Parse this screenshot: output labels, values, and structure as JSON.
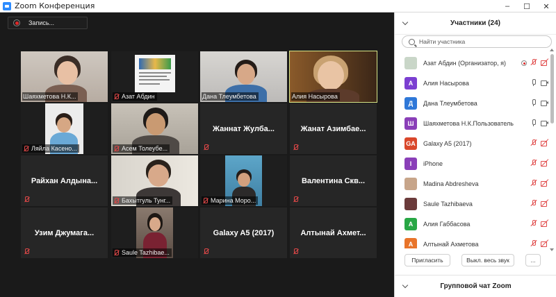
{
  "window": {
    "title": "Zoom Конференция"
  },
  "recording": {
    "label": "Запись..."
  },
  "tiles": [
    {
      "name": "Шаяхметова Н.К...",
      "muted": false,
      "video": true
    },
    {
      "name": "Азат Абдин",
      "muted": true,
      "video": true
    },
    {
      "name": "Дана Тлеумбетова",
      "muted": false,
      "video": true
    },
    {
      "name": "Алия Насырова",
      "muted": false,
      "video": true,
      "active": true
    },
    {
      "name": "Ляйла Касено...",
      "muted": true,
      "video": true
    },
    {
      "name": "Асем Толеубе...",
      "muted": true,
      "video": true
    },
    {
      "name": "Жаннат Жулба...",
      "muted": true,
      "video": false
    },
    {
      "name": "Жанат Азимбае...",
      "muted": true,
      "video": false
    },
    {
      "name": "Райхан Алдына...",
      "muted": true,
      "video": false
    },
    {
      "name": "Бахытгуль Тунг...",
      "muted": true,
      "video": true
    },
    {
      "name": "Марина Моро...",
      "muted": true,
      "video": true
    },
    {
      "name": "Валентина Скв...",
      "muted": true,
      "video": false
    },
    {
      "name": "Узим Джумага...",
      "muted": true,
      "video": false
    },
    {
      "name": "Saule Tazhibae...",
      "muted": true,
      "video": true
    },
    {
      "name": "Galaxy A5 (2017)",
      "muted": true,
      "video": false
    },
    {
      "name": "Алтынай Ахмет...",
      "muted": true,
      "video": false
    }
  ],
  "participants_panel": {
    "title": "Участники (24)",
    "search_placeholder": "Найти участника",
    "participants": [
      {
        "name": "Азат Абдин (Организатор, я)",
        "avatar_letter": "",
        "avatar_color": "#c9d6c8",
        "mic": "off",
        "cam": "off",
        "host": true
      },
      {
        "name": "Алия Насырова",
        "avatar_letter": "А",
        "avatar_color": "#7b3fd1",
        "mic": "on",
        "cam": "on"
      },
      {
        "name": "Дана Тлеумбетова",
        "avatar_letter": "Д",
        "avatar_color": "#2f78d8",
        "mic": "on",
        "cam": "on"
      },
      {
        "name": "Шаяхметова Н.К.Пользователь",
        "avatar_letter": "Ш",
        "avatar_color": "#8a3fb8",
        "mic": "on",
        "cam": "on"
      },
      {
        "name": "Galaxy A5 (2017)",
        "avatar_letter": "GA",
        "avatar_color": "#d9472b",
        "mic": "off",
        "cam": "off"
      },
      {
        "name": "iPhone",
        "avatar_letter": "I",
        "avatar_color": "#8a3fb8",
        "mic": "off",
        "cam": "off"
      },
      {
        "name": "Madina Abdresheva",
        "avatar_letter": "",
        "avatar_color": "#c7a58a",
        "mic": "off",
        "cam": "off"
      },
      {
        "name": "Saule Tazhibaeva",
        "avatar_letter": "",
        "avatar_color": "#6b3b3b",
        "mic": "off",
        "cam": "off"
      },
      {
        "name": "Алия Габбасова",
        "avatar_letter": "А",
        "avatar_color": "#28a745",
        "mic": "off",
        "cam": "off"
      },
      {
        "name": "Алтынай Ахметова",
        "avatar_letter": "А",
        "avatar_color": "#e8742a",
        "mic": "off",
        "cam": "off"
      }
    ],
    "invite_label": "Пригласить",
    "mute_all_label": "Выкл. весь звук",
    "more_label": "..."
  },
  "chat": {
    "title": "Групповой чат Zoom"
  },
  "colors": {
    "active_speaker": "#d9e88a",
    "muted": "#e04848",
    "tile_bg": "#262626"
  }
}
